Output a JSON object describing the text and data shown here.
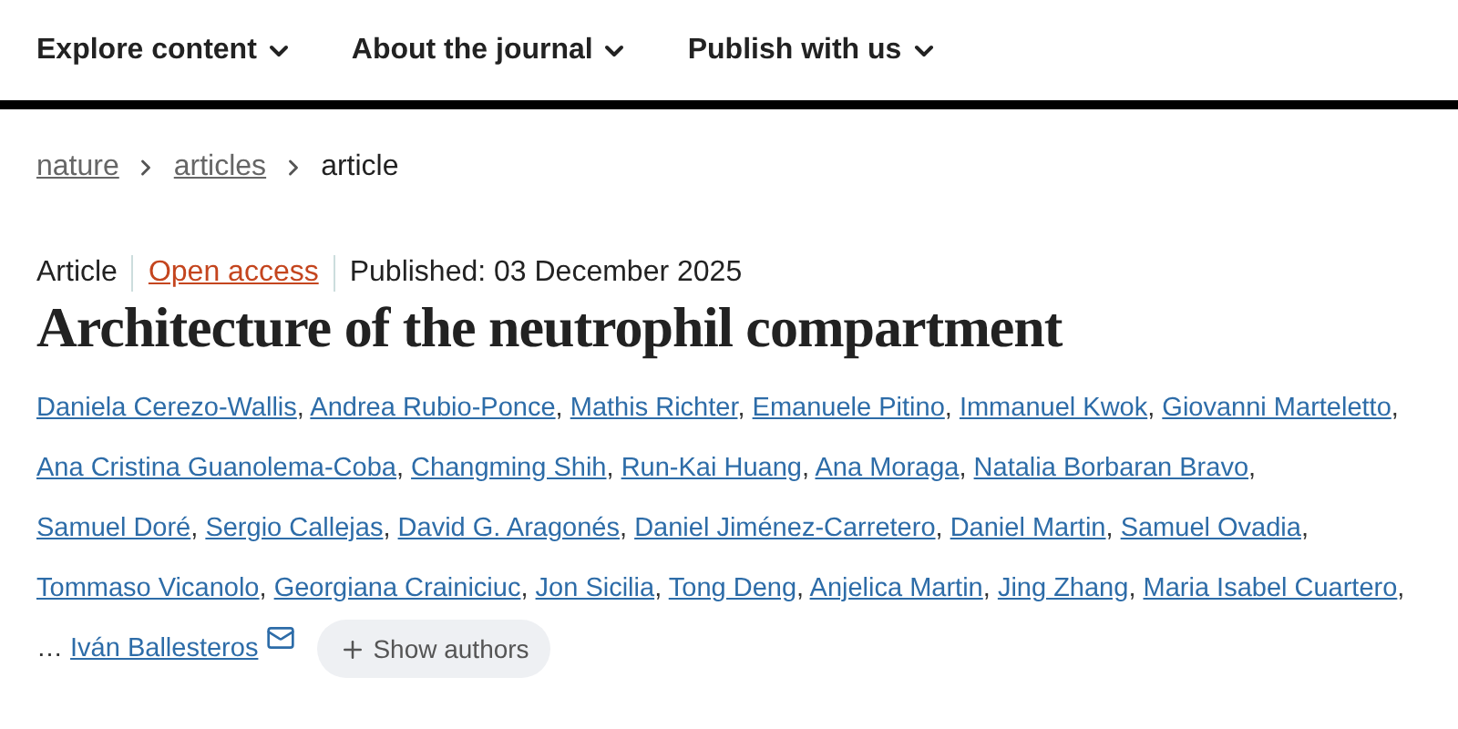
{
  "nav": {
    "items": [
      {
        "label": "Explore content"
      },
      {
        "label": "About the journal"
      },
      {
        "label": "Publish with us"
      }
    ]
  },
  "breadcrumbs": [
    {
      "label": "nature",
      "kind": "link"
    },
    {
      "label": "articles",
      "kind": "link"
    },
    {
      "label": "article",
      "kind": "current"
    }
  ],
  "article": {
    "type": "Article",
    "access": "Open access",
    "published": "Published: 03 December 2025",
    "title": "Architecture of the neutrophil compartment",
    "authors": [
      "Daniela Cerezo-Wallis",
      "Andrea Rubio-Ponce",
      "Mathis Richter",
      "Emanuele Pitino",
      "Immanuel Kwok",
      "Giovanni Marteletto",
      "Ana Cristina Guanolema-Coba",
      "Changming Shih",
      "Run-Kai Huang",
      "Ana Moraga",
      "Natalia Borbaran Bravo",
      "Samuel Doré",
      "Sergio Callejas",
      "David G. Aragonés",
      "Daniel Jiménez-Carretero",
      "Daniel Martin",
      "Samuel Ovadia",
      "Tommaso Vicanolo",
      "Georgiana Crainiciuc",
      "Jon Sicilia",
      "Tong Deng",
      "Anjelica Martin",
      "Jing Zhang",
      "Maria Isabel Cuartero"
    ],
    "separator": ",",
    "ellipsis": "…",
    "last_author": "Iván Ballesteros",
    "show_authors": "Show authors"
  }
}
